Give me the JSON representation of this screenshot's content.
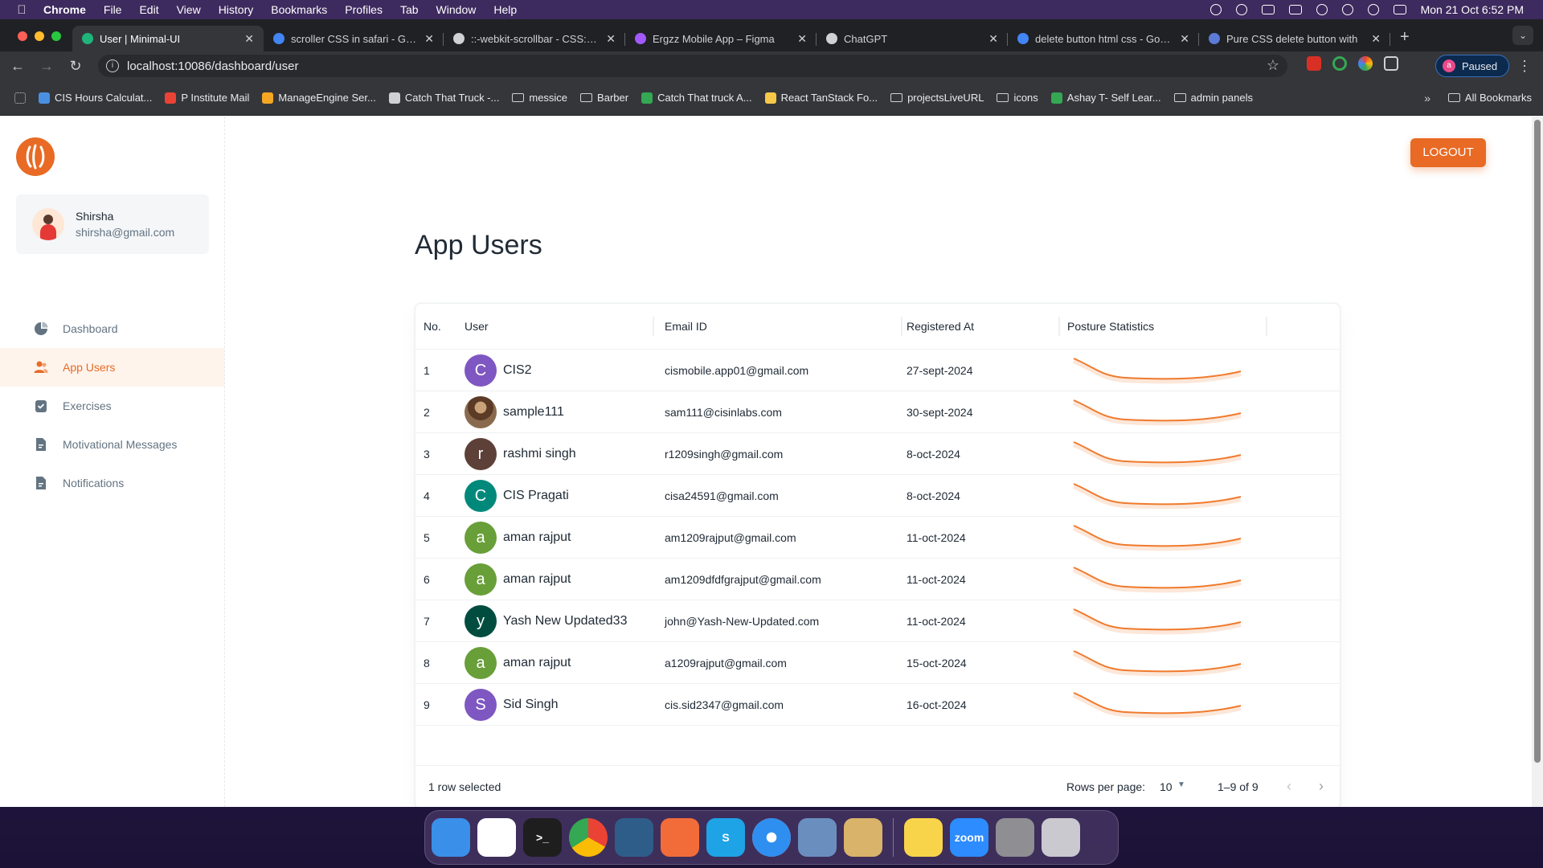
{
  "menubar": {
    "app": "Chrome",
    "items": [
      "File",
      "Edit",
      "View",
      "History",
      "Bookmarks",
      "Profiles",
      "Tab",
      "Window",
      "Help"
    ],
    "clock": "Mon 21 Oct  6:52 PM"
  },
  "browser": {
    "tabs": [
      {
        "title": "User | Minimal-UI",
        "active": true,
        "color": "#1fb57a"
      },
      {
        "title": "scroller CSS in safari - Google",
        "active": false,
        "color": "#4285f4"
      },
      {
        "title": "::-webkit-scrollbar - CSS: Casc",
        "active": false,
        "color": "#cfd1d4"
      },
      {
        "title": "Ergzz Mobile App – Figma",
        "active": false,
        "color": "#a259ff"
      },
      {
        "title": "ChatGPT",
        "active": false,
        "color": "#cfd1d4"
      },
      {
        "title": "delete button html css - Google",
        "active": false,
        "color": "#4285f4"
      },
      {
        "title": "Pure CSS delete button with",
        "active": false,
        "color": "#5b7bd6"
      }
    ],
    "url": "localhost:10086/dashboard/user",
    "profile_label": "Paused",
    "profile_initial": "a",
    "bookmarks": [
      {
        "label": "CIS Hours Calculat...",
        "color": "#4a90e2",
        "type": "site"
      },
      {
        "label": "P Institute Mail",
        "color": "#ea4335",
        "type": "site"
      },
      {
        "label": "ManageEngine Ser...",
        "color": "#f5a623",
        "type": "site"
      },
      {
        "label": "Catch That Truck -...",
        "color": "#cfd1d4",
        "type": "site"
      },
      {
        "label": "messice",
        "color": "",
        "type": "folder"
      },
      {
        "label": "Barber",
        "color": "",
        "type": "folder"
      },
      {
        "label": "Catch That truck A...",
        "color": "#34a853",
        "type": "site"
      },
      {
        "label": "React TanStack Fo...",
        "color": "#f7c948",
        "type": "site"
      },
      {
        "label": "projectsLiveURL",
        "color": "",
        "type": "folder"
      },
      {
        "label": "icons",
        "color": "",
        "type": "folder"
      },
      {
        "label": "Ashay T- Self Lear...",
        "color": "#34a853",
        "type": "site"
      },
      {
        "label": "admin panels",
        "color": "",
        "type": "folder"
      }
    ],
    "more_bookmarks": "»",
    "all_bookmarks": "All Bookmarks"
  },
  "app": {
    "logout_label": "LOGOUT",
    "user": {
      "name": "Shirsha",
      "email": "shirsha@gmail.com"
    },
    "nav": [
      {
        "label": "Dashboard",
        "icon": "pie-chart-icon",
        "active": false
      },
      {
        "label": "App Users",
        "icon": "people-icon",
        "active": true
      },
      {
        "label": "Exercises",
        "icon": "clipboard-icon",
        "active": false
      },
      {
        "label": "Motivational Messages",
        "icon": "document-icon",
        "active": false
      },
      {
        "label": "Notifications",
        "icon": "document-icon",
        "active": false
      }
    ],
    "page_title": "App Users",
    "table": {
      "columns": [
        "No.",
        "User",
        "Email ID",
        "Registered At",
        "Posture Statistics"
      ],
      "rows": [
        {
          "no": "1",
          "initial": "C",
          "name": "CIS2",
          "email": "cismobile.app01@gmail.com",
          "registered": "27-sept-2024",
          "color": "#7e57c2"
        },
        {
          "no": "2",
          "initial": "",
          "name": "sample111",
          "email": "sam111@cisinlabs.com",
          "registered": "30-sept-2024",
          "color": "#6d4c41"
        },
        {
          "no": "3",
          "initial": "r",
          "name": "rashmi singh",
          "email": "r1209singh@gmail.com",
          "registered": "8-oct-2024",
          "color": "#5d4037"
        },
        {
          "no": "4",
          "initial": "C",
          "name": "CIS Pragati",
          "email": "cisa24591@gmail.com",
          "registered": "8-oct-2024",
          "color": "#00897b"
        },
        {
          "no": "5",
          "initial": "a",
          "name": "aman rajput",
          "email": "am1209rajput@gmail.com",
          "registered": "11-oct-2024",
          "color": "#689f38"
        },
        {
          "no": "6",
          "initial": "a",
          "name": "aman rajput",
          "email": "am1209dfdfgrajput@gmail.com",
          "registered": "11-oct-2024",
          "color": "#689f38"
        },
        {
          "no": "7",
          "initial": "y",
          "name": "Yash New Updated33",
          "email": "john@Yash-New-Updated.com",
          "registered": "11-oct-2024",
          "color": "#004d40"
        },
        {
          "no": "8",
          "initial": "a",
          "name": "aman rajput",
          "email": "a1209rajput@gmail.com",
          "registered": "15-oct-2024",
          "color": "#689f38"
        },
        {
          "no": "9",
          "initial": "S",
          "name": "Sid Singh",
          "email": "cis.sid2347@gmail.com",
          "registered": "16-oct-2024",
          "color": "#7e57c2"
        }
      ],
      "sparkline_color": "#f07a2c",
      "selected_text": "1 row selected",
      "rows_per_page_label": "Rows per page:",
      "rows_per_page_value": "10",
      "range_text": "1–9 of 9"
    }
  },
  "dock": [
    {
      "name": "finder-icon",
      "color": "#3a8fe8",
      "label": ""
    },
    {
      "name": "vscode-icon",
      "color": "#ffffff",
      "label": ""
    },
    {
      "name": "terminal-icon",
      "color": "#1e1e1e",
      "label": ">_"
    },
    {
      "name": "chrome-icon",
      "color": "#ffffff",
      "label": ""
    },
    {
      "name": "mysql-workbench-icon",
      "color": "#2f5d8a",
      "label": ""
    },
    {
      "name": "pencil-app-icon",
      "color": "#f26c3a",
      "label": ""
    },
    {
      "name": "skype-icon",
      "color": "#1ea3e6",
      "label": "S"
    },
    {
      "name": "safari-icon",
      "color": "#e9f2fb",
      "label": ""
    },
    {
      "name": "preview-icon",
      "color": "#6a8fbf",
      "label": ""
    },
    {
      "name": "archive-utility-icon",
      "color": "#d9b36a",
      "label": ""
    },
    {
      "name": "notes-icon",
      "color": "#f8d44a",
      "label": ""
    },
    {
      "name": "zoom-icon",
      "color": "#2d8cff",
      "label": "zoom"
    },
    {
      "name": "system-settings-icon",
      "color": "#8e8e93",
      "label": ""
    },
    {
      "name": "trash-icon",
      "color": "#c9c9cf",
      "label": ""
    }
  ]
}
